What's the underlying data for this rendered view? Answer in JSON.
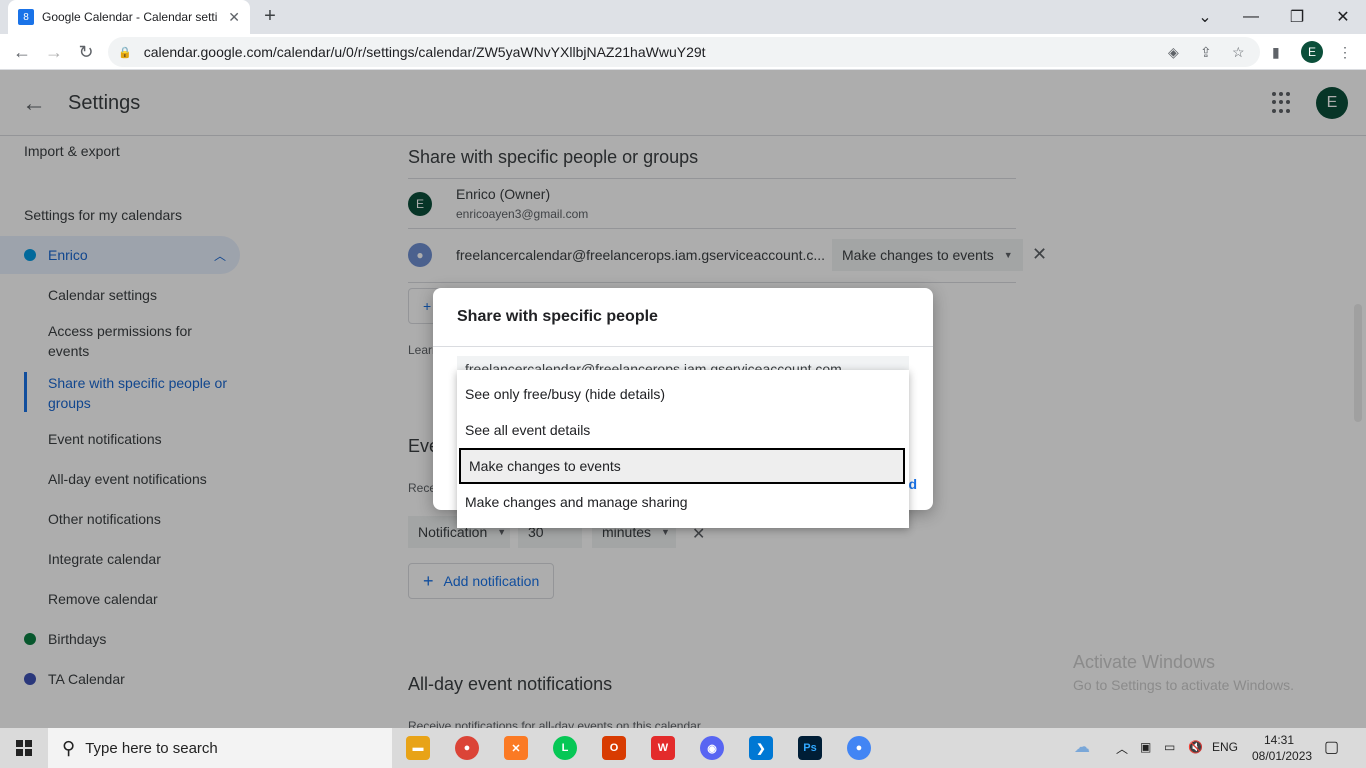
{
  "browser": {
    "tab_title": "Google Calendar - Calendar setti",
    "tab_favicon": "8",
    "url": "calendar.google.com/calendar/u/0/r/settings/calendar/ZW5yaWNvYXllbjNAZ21haWwuY29t",
    "profile_initial": "E",
    "minimize_icon": "—",
    "restore_icon": "❐",
    "close_icon": "✕"
  },
  "header": {
    "title": "Settings",
    "avatar_initial": "E"
  },
  "sidebar": {
    "import_export": "Import & export",
    "settings_for_my_calendars": "Settings for my calendars",
    "enrico": "Enrico",
    "sub_items": [
      "Calendar settings",
      "Access permissions for events",
      "Share with specific people or groups",
      "Event notifications",
      "All-day event notifications",
      "Other notifications",
      "Integrate calendar",
      "Remove calendar"
    ],
    "other_calendars": [
      "Birthdays",
      "TA Calendar"
    ],
    "colors": {
      "enrico": "#039be5",
      "birthdays": "#0b8043",
      "ta": "#3f51b5"
    }
  },
  "main": {
    "share_title": "Share with specific people or groups",
    "owner_name": "Enrico (Owner)",
    "owner_email": "enricoayen3@gmail.com",
    "owner_initial": "E",
    "service_account": "freelancercalendar@freelancerops.iam.gserviceaccount.c...",
    "service_permission": "Make changes to events",
    "learn_more": "Learn",
    "event_title": "Eve",
    "receive_text": "Rece",
    "notification_type": "Notification",
    "notification_value": "30",
    "notification_unit": "minutes",
    "add_notification": "Add notification",
    "allday_title": "All-day event notifications",
    "allday_sub": "Receive notifications for all-day events on this calendar"
  },
  "dialog": {
    "title": "Share with specific people",
    "chip_text": "freelancercalendar@freelancerops.iam.gserviceaccount.com",
    "send_fragment": "d"
  },
  "menu": {
    "options": [
      "See only free/busy (hide details)",
      "See all event details",
      "Make changes to events",
      "Make changes and manage sharing"
    ],
    "selected_index": 2
  },
  "watermark": {
    "line1": "Activate Windows",
    "line2": "Go to Settings to activate Windows."
  },
  "taskbar": {
    "search_placeholder": "Type here to search",
    "lang": "ENG",
    "time": "14:31",
    "date": "08/01/2023"
  }
}
